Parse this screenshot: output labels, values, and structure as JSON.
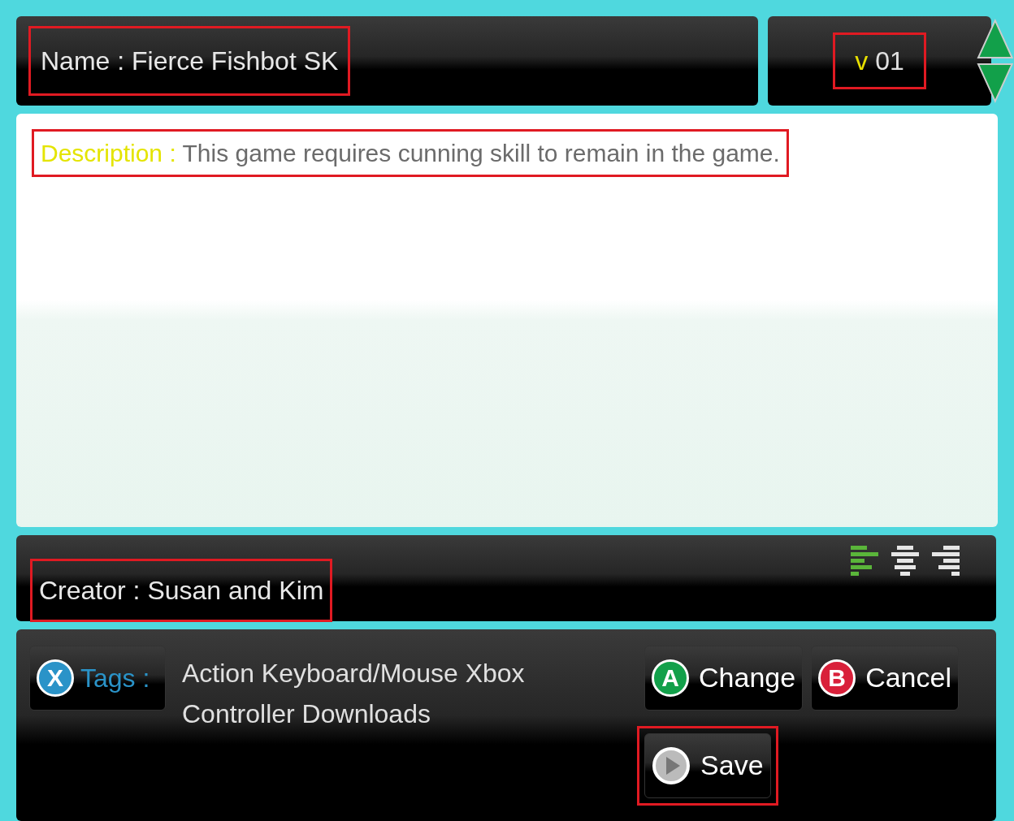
{
  "name_field": {
    "label": "Name :",
    "value": "Fierce Fishbot SK",
    "highlighted": true
  },
  "version": {
    "prefix": "v",
    "value": "01",
    "highlighted": true
  },
  "description": {
    "label": "Description :",
    "value": "This game requires cunning skill to remain in the game.",
    "highlighted": true
  },
  "creator": {
    "label": "Creator :",
    "value": "Susan and Kim",
    "highlighted": true
  },
  "alignment": [
    {
      "kind": "left",
      "selected": true
    },
    {
      "kind": "center",
      "selected": false
    },
    {
      "kind": "right",
      "selected": false
    }
  ],
  "tags": {
    "key": "X",
    "label": "Tags :",
    "lines": [
      "Action Keyboard/Mouse Xbox",
      "Controller Downloads"
    ]
  },
  "buttons": [
    {
      "key": "A",
      "label": "Change",
      "color": "#12a04a",
      "highlighted": false
    },
    {
      "key": "B",
      "label": "Cancel",
      "color": "#d9203a",
      "highlighted": false
    },
    {
      "kind": "play",
      "label": "Save",
      "highlighted": true
    }
  ]
}
